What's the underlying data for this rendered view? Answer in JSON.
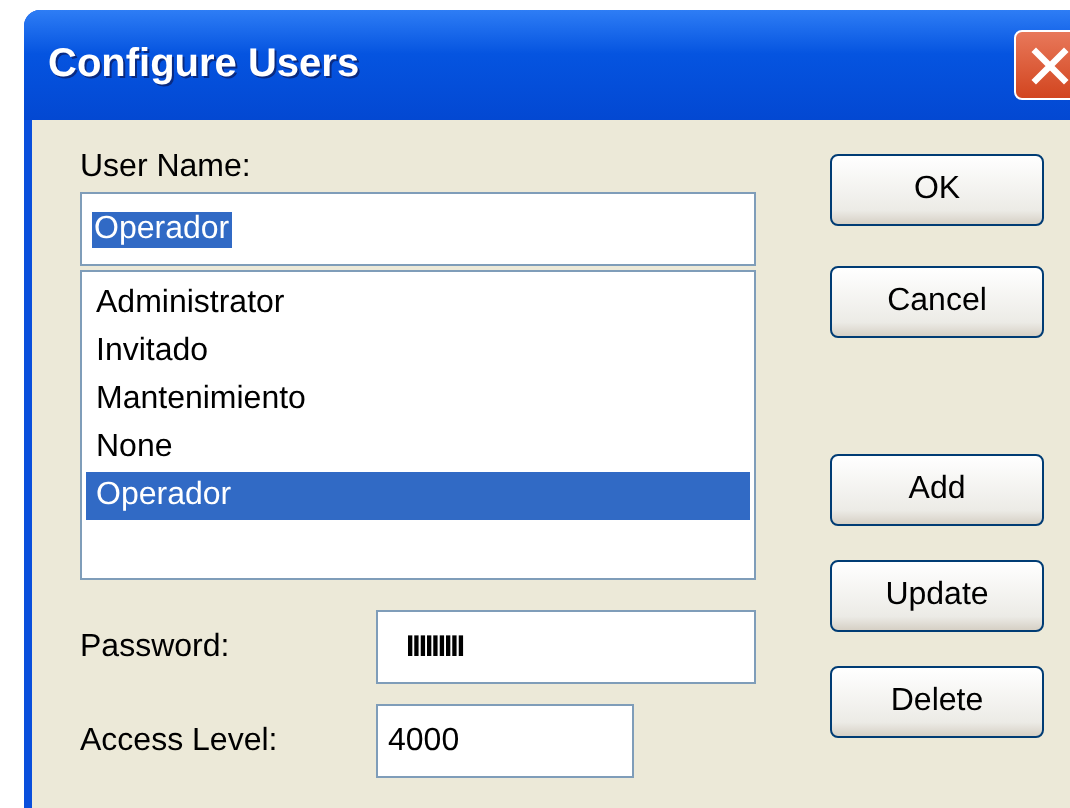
{
  "window": {
    "title": "Configure Users"
  },
  "user_name": {
    "label": "User Name:",
    "value": "Operador",
    "value_selected": true
  },
  "users": [
    {
      "name": "Administrator",
      "selected": false
    },
    {
      "name": "Invitado",
      "selected": false
    },
    {
      "name": "Mantenimiento",
      "selected": false
    },
    {
      "name": "None",
      "selected": false
    },
    {
      "name": "Operador",
      "selected": true
    }
  ],
  "password": {
    "label": "Password:",
    "value": "IIIIIIIII"
  },
  "access_level": {
    "label": "Access Level:",
    "value": "4000"
  },
  "top_buttons": [
    {
      "label": "OK"
    },
    {
      "label": "Cancel"
    }
  ],
  "bottom_buttons": [
    {
      "label": "Add"
    },
    {
      "label": "Update"
    },
    {
      "label": "Delete"
    }
  ]
}
